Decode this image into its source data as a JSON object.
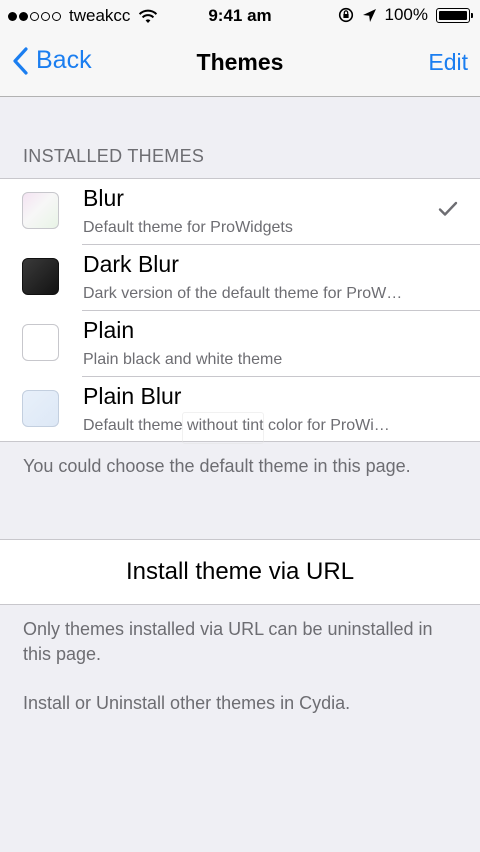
{
  "status_bar": {
    "carrier": "tweakcc",
    "time": "9:41 am",
    "battery_percent": "100%",
    "signal_bars_filled": 2,
    "signal_bars_total": 5
  },
  "nav": {
    "back_label": "Back",
    "title": "Themes",
    "edit_label": "Edit",
    "accent_color": "#1b7ef0"
  },
  "installed": {
    "header": "INSTALLED THEMES",
    "themes": [
      {
        "name": "Blur",
        "description": "Default theme for ProWidgets",
        "selected": true
      },
      {
        "name": "Dark Blur",
        "description": "Dark version of the default theme for ProW…",
        "selected": false
      },
      {
        "name": "Plain",
        "description": "Plain black and white theme",
        "selected": false
      },
      {
        "name": "Plain Blur",
        "description": "Default theme without tint color for ProWi…",
        "selected": false
      }
    ],
    "footer": "You could choose the default theme in this page."
  },
  "install": {
    "button_label": "Install theme via URL",
    "note1": "Only themes installed via URL can be uninstalled in this page.",
    "note2": "Install or Uninstall other themes in Cydia."
  }
}
